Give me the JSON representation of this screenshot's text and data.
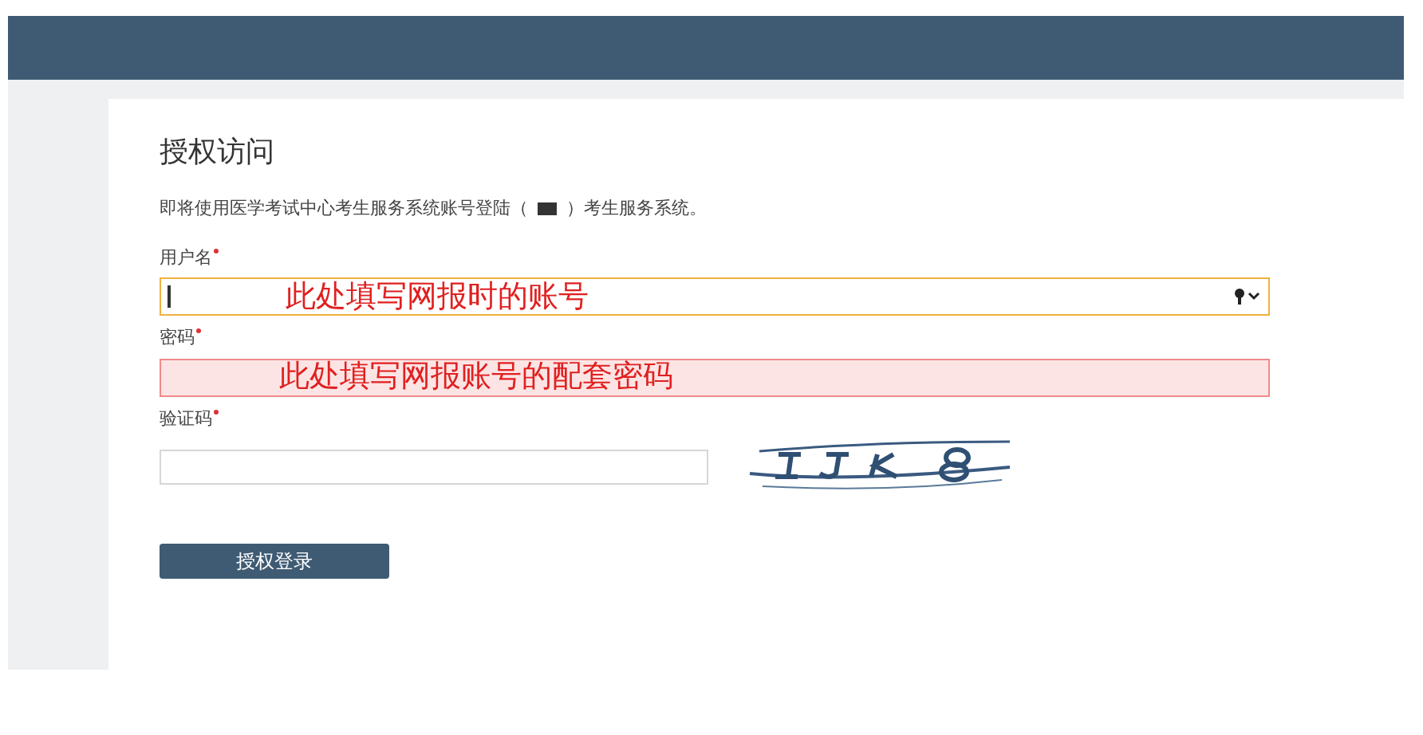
{
  "title": "授权访问",
  "description": {
    "before": "即将使用医学考试中心考生服务系统账号登陆（",
    "after": "）考生服务系统。",
    "redacted": true
  },
  "fields": [
    {
      "label": "用户名",
      "required": true,
      "value": "此处填写网报时的账号",
      "kind": "account",
      "focused": true,
      "highlighted": false
    },
    {
      "label": "密码",
      "required": true,
      "value": "此处填写网报账号的配套密码",
      "kind": "password",
      "focused": false,
      "highlighted": true
    },
    {
      "label": "验证码",
      "required": true,
      "kind": "captcha",
      "focused": false,
      "highlighted": false
    }
  ],
  "button": "授权登录"
}
